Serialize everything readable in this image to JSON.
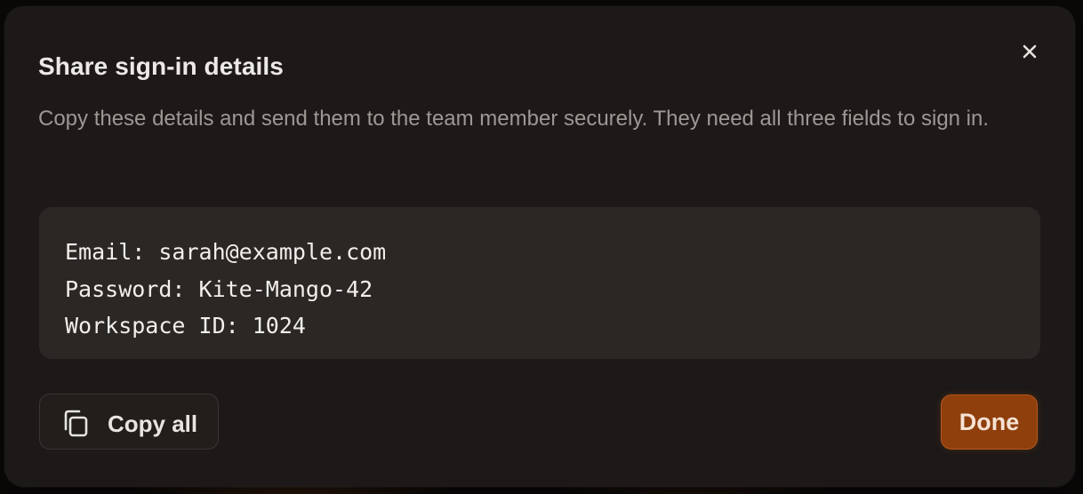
{
  "dialog": {
    "title": "Share sign-in details",
    "description": "Copy these details and send them to the team member securely. They need all three fields to sign in.",
    "close_icon": "close-icon",
    "details": {
      "email_line": "Email: sarah@example.com",
      "password_line": "Password: Kite-Mango-42",
      "workspace_line": "Workspace ID: 1024"
    },
    "actions": {
      "copy_all_label": "Copy all",
      "copy_icon": "copy-icon",
      "done_label": "Done"
    }
  },
  "colors": {
    "dialog_background": "#1c1918",
    "details_background": "#2b2725",
    "accent": "#8f3f0c",
    "title_text": "#ece9e6",
    "muted_text": "#9d9894"
  }
}
